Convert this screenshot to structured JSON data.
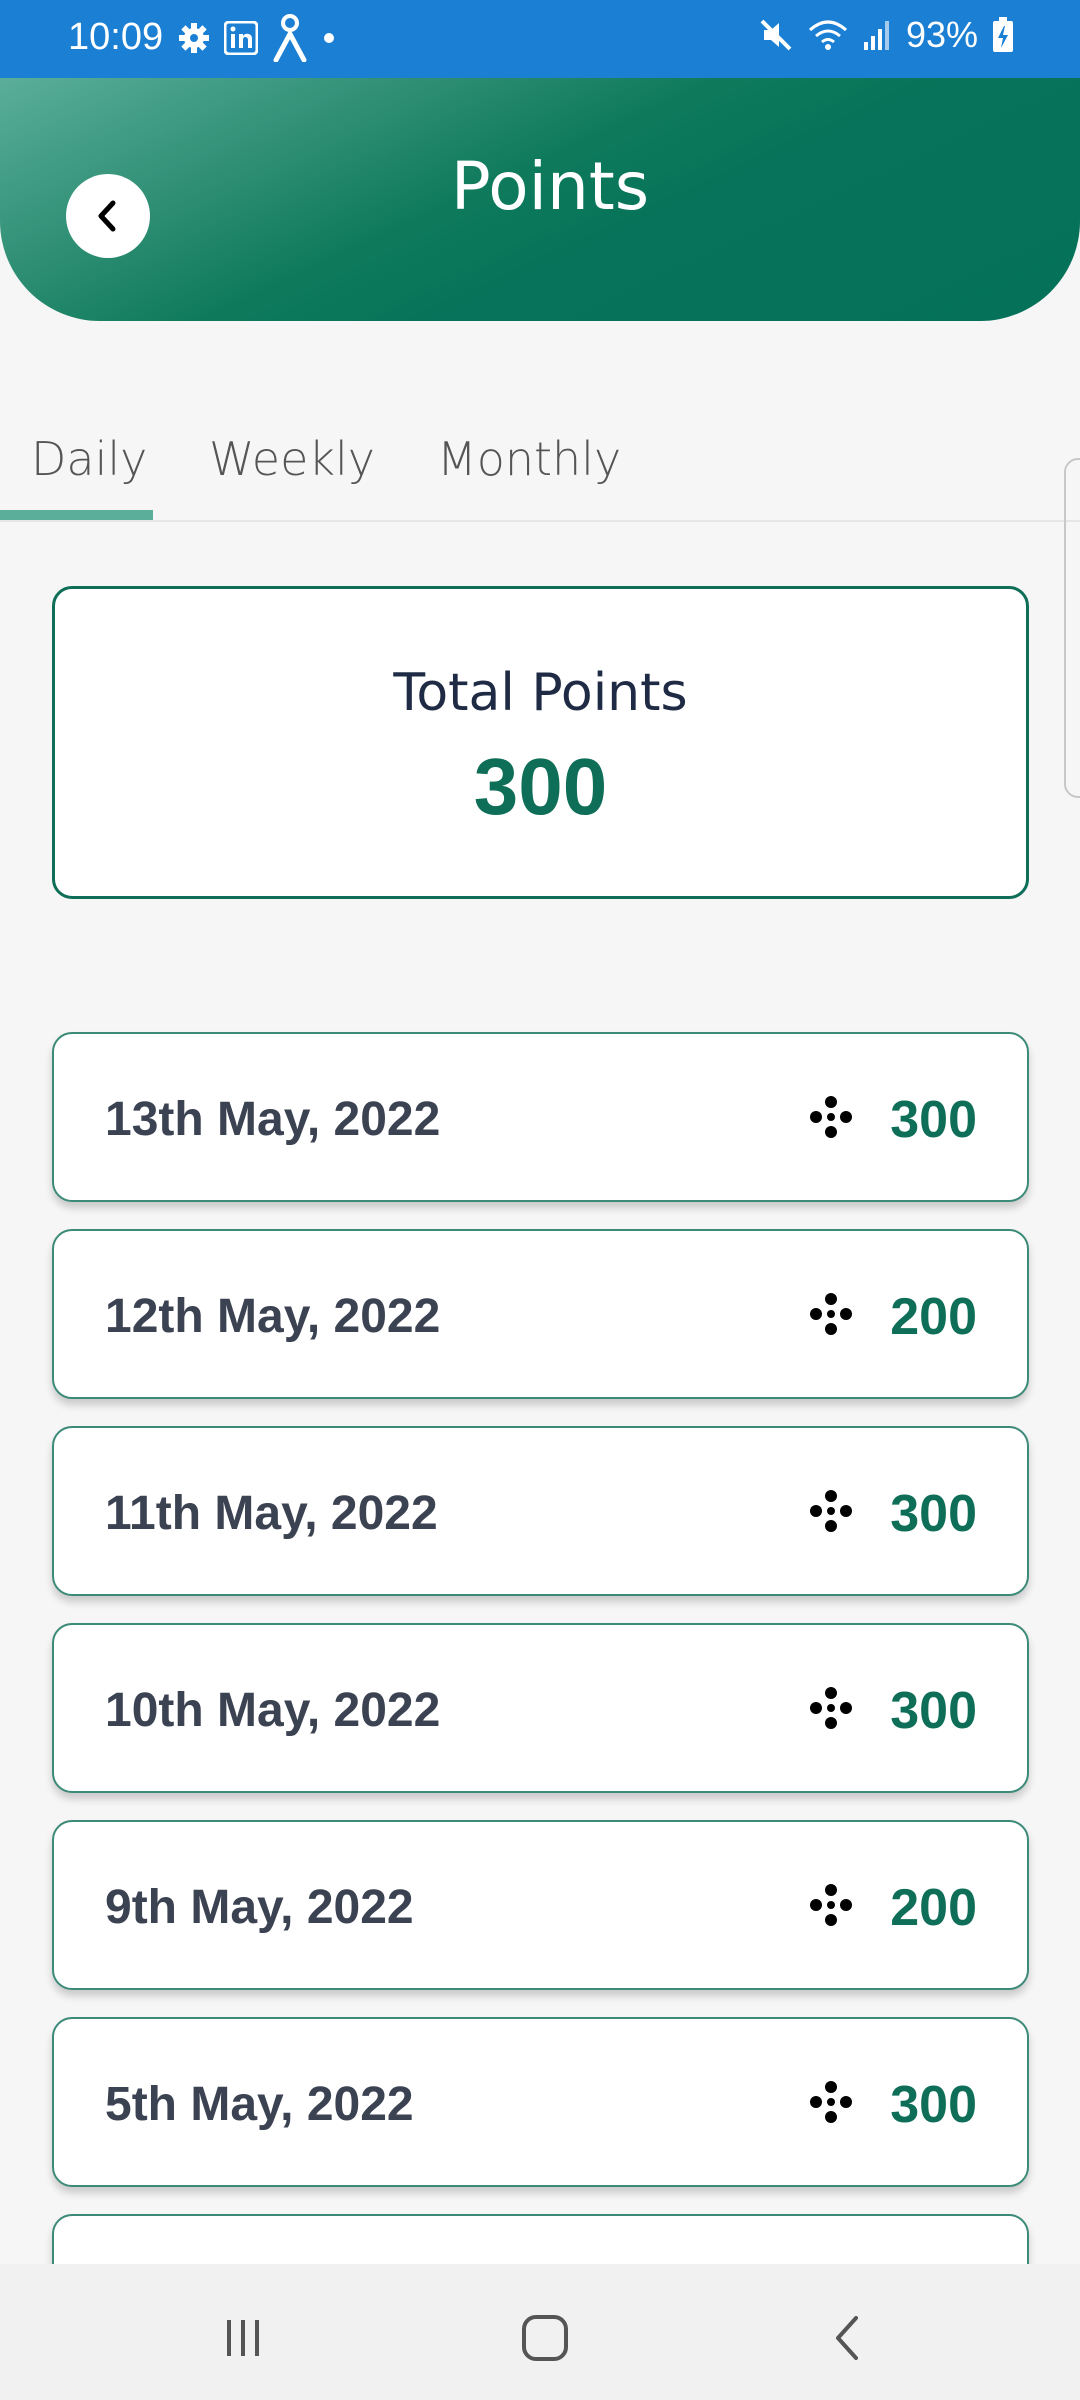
{
  "status_bar": {
    "time": "10:09",
    "battery": "93%",
    "left_icons": [
      "gear-icon",
      "linkedin-icon",
      "accessibility-icon",
      "dot-icon"
    ],
    "right_icons": [
      "mute-icon",
      "wifi-icon",
      "signal-icon",
      "battery-charging-icon"
    ]
  },
  "header": {
    "title": "Points",
    "back_icon": "chevron-left-icon"
  },
  "tabs": [
    {
      "label": "Daily",
      "active": true
    },
    {
      "label": "Weekly",
      "active": false
    },
    {
      "label": "Monthly",
      "active": false
    }
  ],
  "summary": {
    "label": "Total Points",
    "value": "300"
  },
  "entries": [
    {
      "date": "13th May, 2022",
      "points": "300"
    },
    {
      "date": "12th May, 2022",
      "points": "200"
    },
    {
      "date": "11th May, 2022",
      "points": "300"
    },
    {
      "date": "10th May, 2022",
      "points": "300"
    },
    {
      "date": "9th May, 2022",
      "points": "200"
    },
    {
      "date": "5th May, 2022",
      "points": "300"
    }
  ],
  "nav": {
    "buttons": [
      "recent-apps-icon",
      "home-icon",
      "back-icon"
    ]
  },
  "colors": {
    "accent": "#0e6e58",
    "status_bar": "#1b7fd4",
    "date_text": "#3b4252"
  }
}
